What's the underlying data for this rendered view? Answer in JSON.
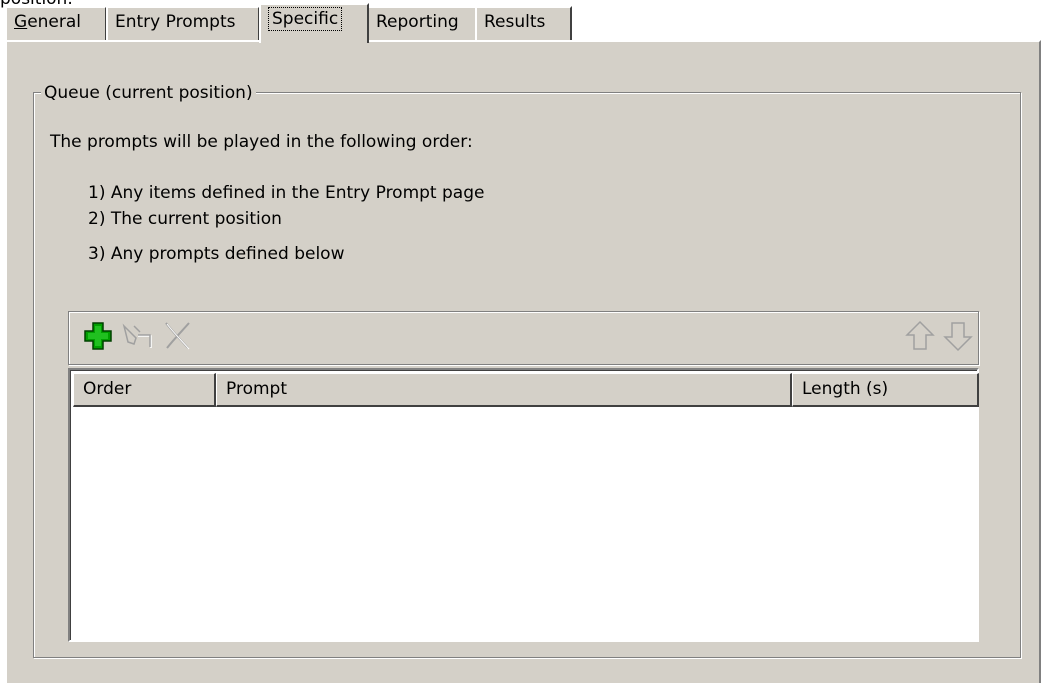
{
  "page": {
    "top_fragment": "position."
  },
  "tabs": [
    {
      "label": "eneral",
      "accel": "G",
      "active": false
    },
    {
      "label": "Entry Prompts",
      "active": false
    },
    {
      "label": "Specific",
      "active": true
    },
    {
      "label": "Reporting",
      "active": false
    },
    {
      "label": "Results",
      "active": false
    }
  ],
  "group": {
    "title": "Queue (current position)",
    "intro": "The prompts will be played in the following order:",
    "steps": [
      "1) Any items defined in the Entry Prompt page",
      "2) The current position",
      "3) Any prompts defined below"
    ]
  },
  "toolbar": {
    "icons": [
      "add-icon",
      "edit-icon",
      "delete-icon",
      "move-up-icon",
      "move-down-icon"
    ],
    "add_color": "#00a000"
  },
  "table": {
    "columns": [
      "Order",
      "Prompt",
      "Length (s)"
    ],
    "rows": []
  },
  "colors": {
    "panel": "#d4d0c8",
    "shadow": "#808080",
    "highlight": "#ffffff"
  }
}
